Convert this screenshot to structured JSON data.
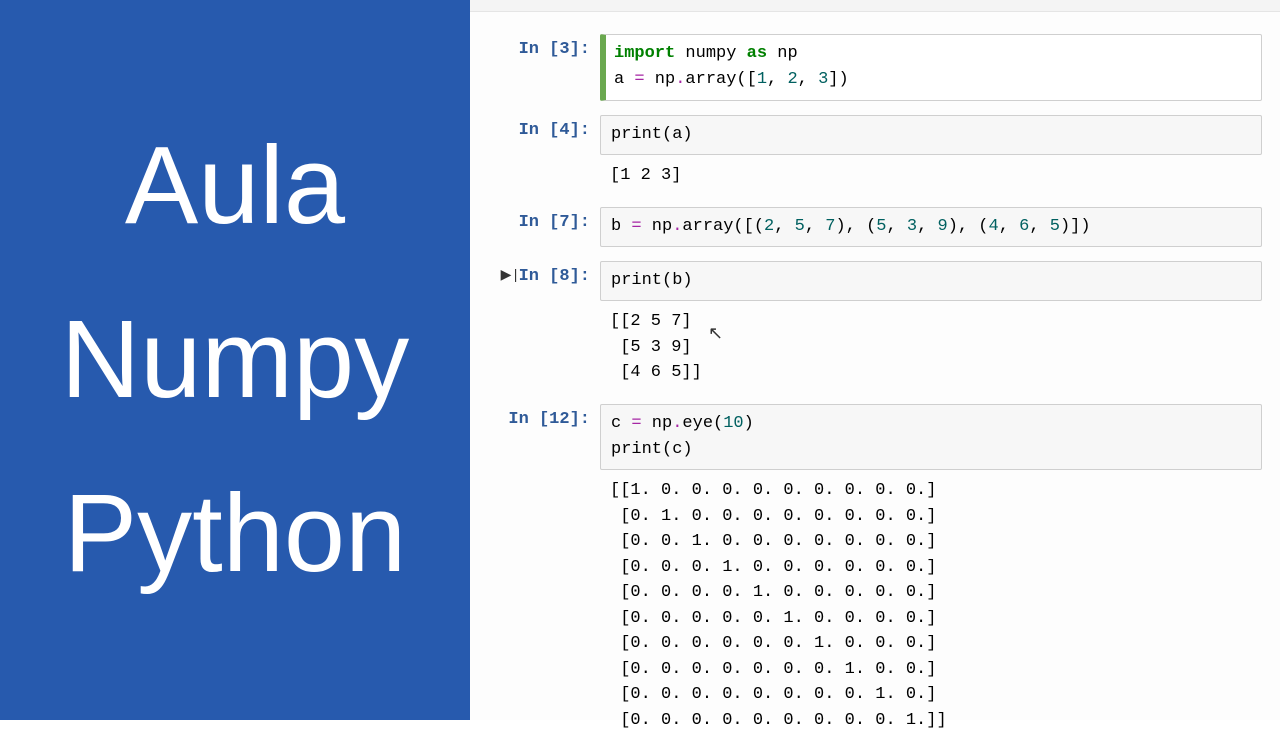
{
  "left": {
    "line1": "Aula",
    "line2": "Numpy",
    "line3": "Python"
  },
  "cells": [
    {
      "prompt": "In [3]:",
      "selected": true,
      "code_html": "<span class='kw'>import</span> numpy <span class='kw'>as</span> np\na <span class='op'>=</span> np<span class='op'>.</span>array([<span class='num'>1</span>, <span class='num'>2</span>, <span class='num'>3</span>])",
      "output": null
    },
    {
      "prompt": "In [4]:",
      "selected": false,
      "code_html": "<span class='fn'>print</span>(a)",
      "output": "[1 2 3]"
    },
    {
      "prompt": "In [7]:",
      "selected": false,
      "code_html": "b <span class='op'>=</span> np<span class='op'>.</span>array([(<span class='num'>2</span>, <span class='num'>5</span>, <span class='num'>7</span>), (<span class='num'>5</span>, <span class='num'>3</span>, <span class='num'>9</span>), (<span class='num'>4</span>, <span class='num'>6</span>, <span class='num'>5</span>)])",
      "output": null
    },
    {
      "prompt": "In [8]:",
      "selected": false,
      "has_run_icon": true,
      "code_html": "<span class='fn'>print</span>(b)",
      "output": "[[2 5 7]\n [5 3 9]\n [4 6 5]]"
    },
    {
      "prompt": "In [12]:",
      "selected": false,
      "code_html": "c <span class='op'>=</span> np<span class='op'>.</span>eye(<span class='num'>10</span>)\n<span class='fn'>print</span>(c)",
      "output": "[[1. 0. 0. 0. 0. 0. 0. 0. 0. 0.]\n [0. 1. 0. 0. 0. 0. 0. 0. 0. 0.]\n [0. 0. 1. 0. 0. 0. 0. 0. 0. 0.]\n [0. 0. 0. 1. 0. 0. 0. 0. 0. 0.]\n [0. 0. 0. 0. 1. 0. 0. 0. 0. 0.]\n [0. 0. 0. 0. 0. 1. 0. 0. 0. 0.]\n [0. 0. 0. 0. 0. 0. 1. 0. 0. 0.]\n [0. 0. 0. 0. 0. 0. 0. 1. 0. 0.]\n [0. 0. 0. 0. 0. 0. 0. 0. 1. 0.]\n [0. 0. 0. 0. 0. 0. 0. 0. 0. 1.]]"
    }
  ],
  "cursor_glyph": "↖",
  "run_icon_glyph": "▶|"
}
